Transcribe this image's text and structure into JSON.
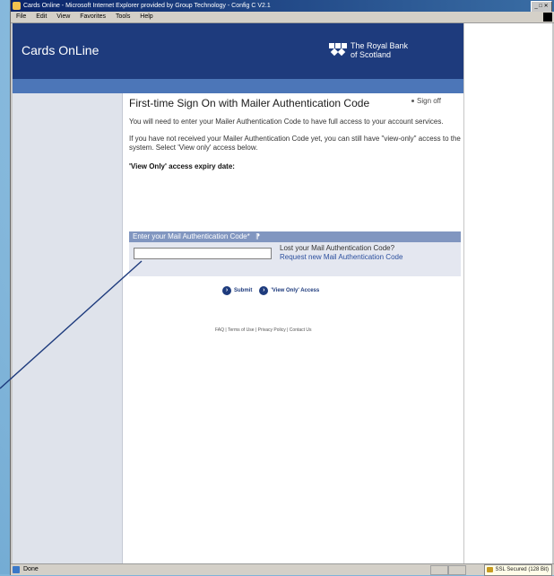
{
  "window": {
    "title": "Cards Online - Microsoft Internet Explorer provided by Group Technology - Config C V2.1"
  },
  "menu": [
    "File",
    "Edit",
    "View",
    "Favorites",
    "Tools",
    "Help"
  ],
  "header": {
    "brand": "Cards OnLine",
    "bank_line1": "The Royal Bank",
    "bank_line2": "of Scotland"
  },
  "main": {
    "title": "First-time Sign On with Mailer Authentication Code",
    "sign_off": "Sign off",
    "para1": "You will need to enter your Mailer Authentication Code to have full access to your account services.",
    "para2": "If you have not received your Mailer Authentication Code yet, you can still have \"view-only\" access to the system. Select 'View only' access below.",
    "expiry_label": "'View Only' access expiry date:"
  },
  "auth_panel": {
    "heading": "Enter your Mail Authentication Code*",
    "input_value": "",
    "lost_label": "Lost your Mail Authentication Code?",
    "request_link": "Request new Mail Authentication Code"
  },
  "actions": {
    "submit_label": "Submit",
    "view_only_label": "'View Only' Access"
  },
  "footer": {
    "faq": "FAQ",
    "terms": "Terms of Use",
    "privacy": "Privacy Policy",
    "contact": "Contact Us",
    "separator": "|"
  },
  "status": {
    "text": "Done",
    "ssl": "SSL Secured (128 Bit)"
  },
  "colors": {
    "header_blue": "#1e3b7d",
    "subnav_blue": "#4c76b8",
    "panel_head": "#8196c0",
    "link": "#2b4f9e"
  }
}
